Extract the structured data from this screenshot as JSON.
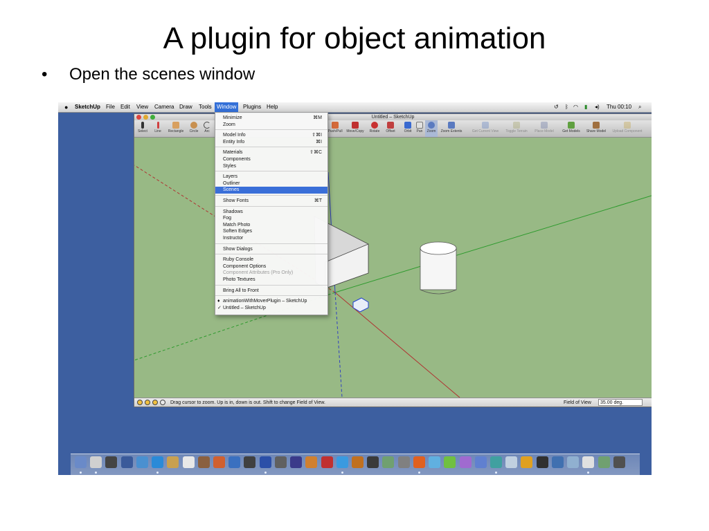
{
  "slide": {
    "title": "A plugin for object animation",
    "bullet": "Open the scenes window",
    "bullet_marker": "•"
  },
  "menubar": {
    "apple_icon": "apple-icon",
    "items": [
      "SketchUp",
      "File",
      "Edit",
      "View",
      "Camera",
      "Draw",
      "Tools",
      "Window",
      "Plugins",
      "Help"
    ],
    "active_index": 7,
    "clock": "Thu 00:10"
  },
  "window": {
    "title": "Untitled – SketchUp",
    "toolbar_left": [
      "Select",
      "Line",
      "Rectangle",
      "Circle",
      "Arc"
    ],
    "toolbar_right": [
      {
        "label": "Push/Pull",
        "enabled": true
      },
      {
        "label": "Move/Copy",
        "enabled": true
      },
      {
        "label": "Rotate",
        "enabled": true
      },
      {
        "label": "Offset",
        "enabled": true
      },
      {
        "label": "Orbit",
        "enabled": true
      },
      {
        "label": "Pan",
        "enabled": true
      },
      {
        "label": "Zoom",
        "enabled": true
      },
      {
        "label": "Zoom Extents",
        "enabled": true
      },
      {
        "label": "Get Current View",
        "enabled": false
      },
      {
        "label": "Toggle Terrain",
        "enabled": false
      },
      {
        "label": "Place Model",
        "enabled": false
      },
      {
        "label": "Get Models",
        "enabled": true
      },
      {
        "label": "Share Model",
        "enabled": true
      },
      {
        "label": "Upload Component",
        "enabled": false
      }
    ],
    "status_text": "Drag cursor to zoom.  Up is in, down is out. Shift to change Field of View.",
    "fov_label": "Field of View",
    "fov_value": "35.00 deg."
  },
  "window_menu": {
    "groups": [
      [
        {
          "label": "Minimize",
          "shortcut": "⌘M"
        },
        {
          "label": "Zoom",
          "shortcut": ""
        }
      ],
      [
        {
          "label": "Model Info",
          "shortcut": "⇧⌘I"
        },
        {
          "label": "Entity Info",
          "shortcut": "⌘I"
        }
      ],
      [
        {
          "label": "Materials",
          "shortcut": "⇧⌘C"
        },
        {
          "label": "Components",
          "shortcut": ""
        },
        {
          "label": "Styles",
          "shortcut": ""
        }
      ],
      [
        {
          "label": "Layers",
          "shortcut": ""
        },
        {
          "label": "Outliner",
          "shortcut": ""
        },
        {
          "label": "Scenes",
          "shortcut": "",
          "selected": true
        }
      ],
      [
        {
          "label": "Show Fonts",
          "shortcut": "⌘T"
        }
      ],
      [
        {
          "label": "Shadows",
          "shortcut": ""
        },
        {
          "label": "Fog",
          "shortcut": ""
        },
        {
          "label": "Match Photo",
          "shortcut": ""
        },
        {
          "label": "Soften Edges",
          "shortcut": ""
        },
        {
          "label": "Instructor",
          "shortcut": ""
        }
      ],
      [
        {
          "label": "Show Dialogs",
          "shortcut": ""
        }
      ],
      [
        {
          "label": "Ruby Console",
          "shortcut": ""
        },
        {
          "label": "Component Options",
          "shortcut": ""
        },
        {
          "label": "Component Attributes (Pro Only)",
          "shortcut": "",
          "disabled": true
        },
        {
          "label": "Photo Textures",
          "shortcut": ""
        }
      ],
      [
        {
          "label": "Bring All to Front",
          "shortcut": ""
        }
      ],
      [
        {
          "label": "animationWithMoverPlugin – SketchUp",
          "shortcut": "",
          "mark": "♦"
        },
        {
          "label": "Untitled – SketchUp",
          "shortcut": "",
          "mark": "✓"
        }
      ]
    ]
  },
  "colors": {
    "desktop": "#3d5fa0",
    "viewport": "#98b985",
    "menu_highlight": "#3a6fd8"
  }
}
